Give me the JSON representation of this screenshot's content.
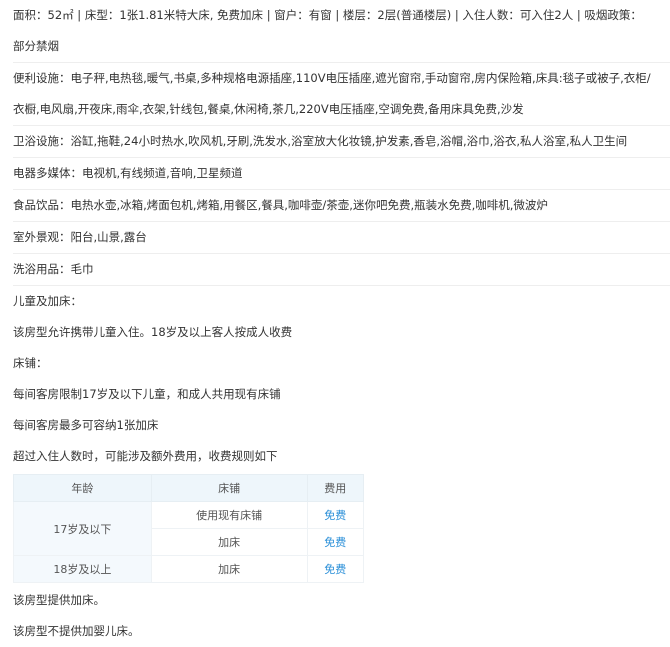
{
  "basic": {
    "line1": "面积：52㎡ | 床型：1张1.81米特大床, 免费加床 | 窗户：有窗 | 楼层：2层(普通楼层) | 入住人数：可入住2人 | 吸烟政策：",
    "line2": "部分禁烟"
  },
  "facilities": {
    "convenience": {
      "line1": "便利设施：电子秤,电热毯,暖气,书桌,多种规格电源插座,110V电压插座,遮光窗帘,手动窗帘,房内保险箱,床具:毯子或被子,衣柜/",
      "line2": "衣橱,电风扇,开夜床,雨伞,衣架,针线包,餐桌,休闲椅,茶几,220V电压插座,空调免费,备用床具免费,沙发"
    },
    "bathroom": "卫浴设施：浴缸,拖鞋,24小时热水,吹风机,牙刷,洗发水,浴室放大化妆镜,护发素,香皂,浴帽,浴巾,浴衣,私人浴室,私人卫生间",
    "media": "电器多媒体：电视机,有线频道,音响,卫星频道",
    "food": "食品饮品：电热水壶,冰箱,烤面包机,烤箱,用餐区,餐具,咖啡壶/茶壶,迷你吧免费,瓶装水免费,咖啡机,微波炉",
    "outdoor": "室外景观：阳台,山景,露台",
    "toiletries": "洗浴用品：毛巾"
  },
  "children": {
    "heading": "儿童及加床：",
    "policy": "该房型允许携带儿童入住。18岁及以上客人按成人收费",
    "bed_heading": "床铺：",
    "bed_rule1": "每间客房限制17岁及以下儿童，和成人共用现有床铺",
    "bed_rule2": "每间客房最多可容纳1张加床",
    "extra_note": "超过入住人数时，可能涉及额外费用，收费规则如下"
  },
  "fee_table": {
    "headers": [
      "年龄",
      "床铺",
      "费用"
    ],
    "rows": [
      {
        "age": "17岁及以下",
        "bed": "使用现有床铺",
        "fee": "免费"
      },
      {
        "age": "",
        "bed": "加床",
        "fee": "免费"
      },
      {
        "age": "18岁及以上",
        "bed": "加床",
        "fee": "免费"
      }
    ]
  },
  "footer": {
    "extra_bed": "该房型提供加床。",
    "crib": "该房型不提供加婴儿床。"
  }
}
